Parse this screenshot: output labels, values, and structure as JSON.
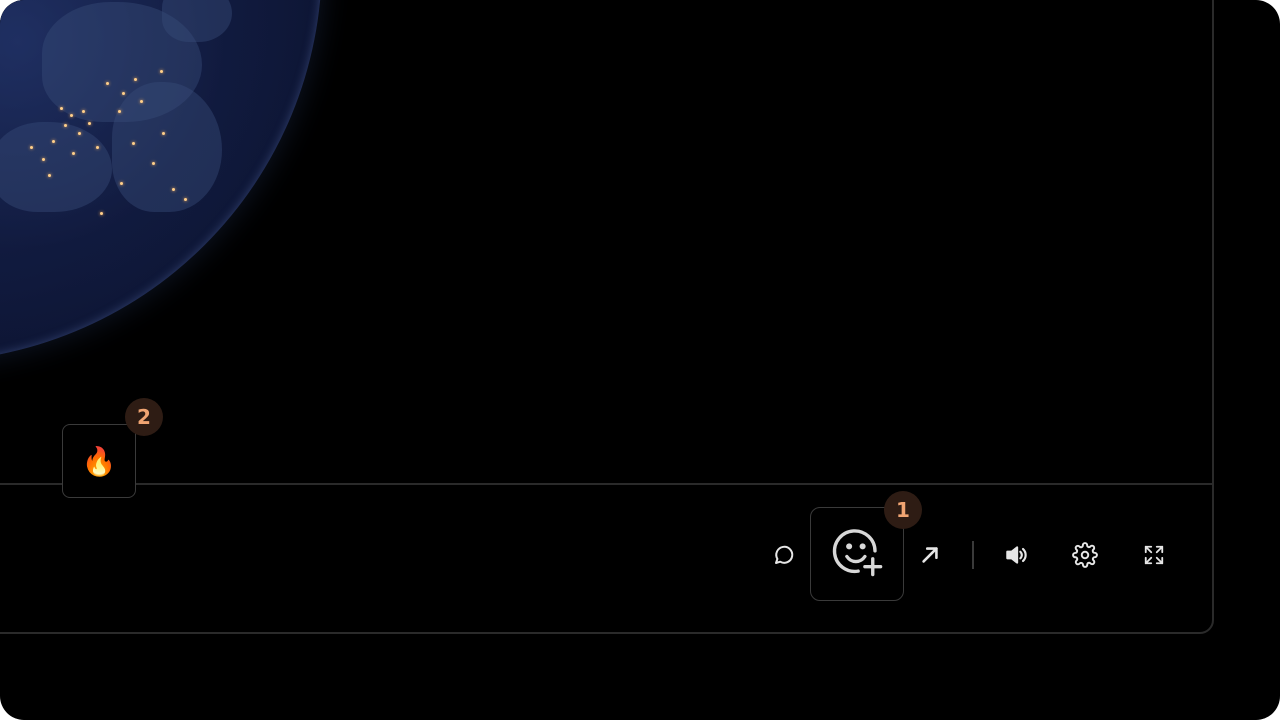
{
  "video": {
    "scene": "earth-at-night"
  },
  "reaction": {
    "emoji": "🔥",
    "count": "2"
  },
  "controls": {
    "chat_icon": "chat-bubble-icon",
    "emoji_add_icon": "emoji-add-icon",
    "emoji_badge": "1",
    "share_icon": "arrow-up-right-icon",
    "volume_icon": "volume-icon",
    "settings_icon": "gear-icon",
    "fullscreen_icon": "fullscreen-icon"
  },
  "colors": {
    "background": "#000000",
    "border": "#2a2a2a",
    "badge_bg": "#2e1c14",
    "badge_text": "#f0a472",
    "icon": "#e6e6e6"
  }
}
